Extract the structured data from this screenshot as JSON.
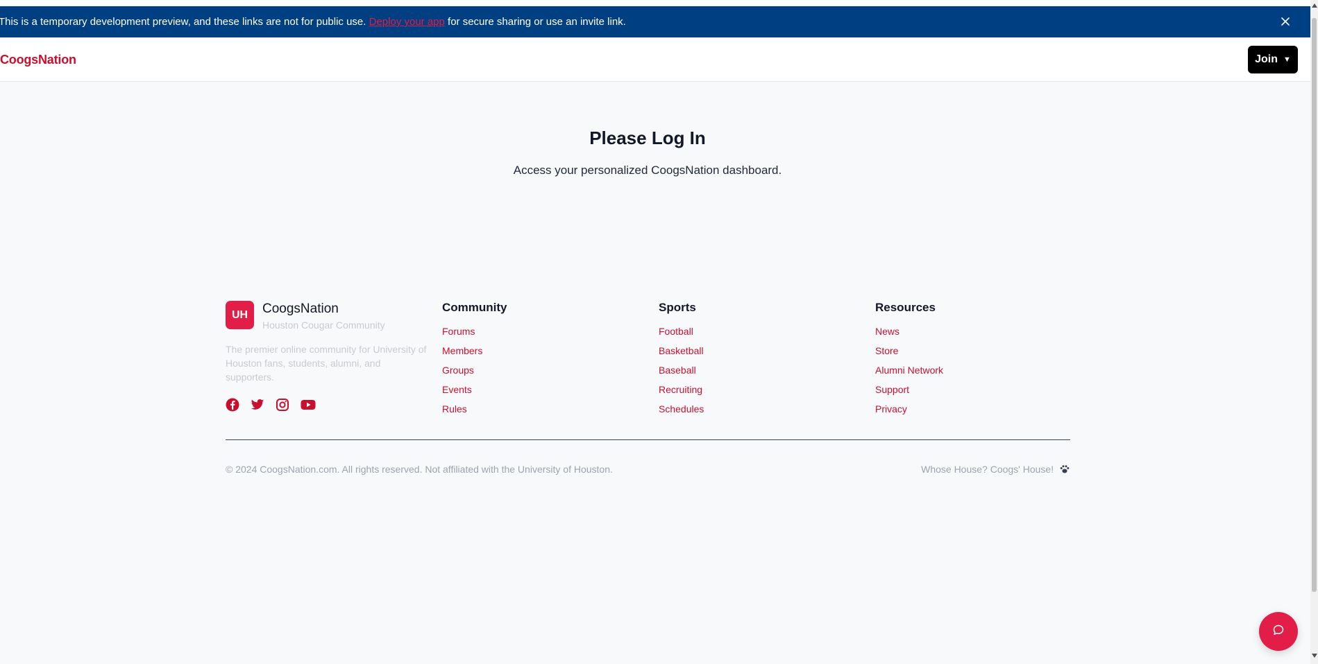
{
  "banner": {
    "text_before": "This is a temporary development preview, and these links are not for public use.",
    "link_text": "Deploy your app",
    "text_after": "for secure sharing or use an invite link.",
    "close_icon": "close-icon"
  },
  "header": {
    "brand": "CoogsNation",
    "join_label": "Join",
    "join_caret": "▼"
  },
  "hero": {
    "title": "Please Log In",
    "subtitle": "Access your personalized CoogsNation dashboard."
  },
  "footer": {
    "logo_text": "UH",
    "name": "CoogsNation",
    "tagline": "Houston Cougar Community",
    "description": "The premier online community for University of Houston fans, students, alumni, and supporters.",
    "socials": [
      "facebook-icon",
      "twitter-icon",
      "instagram-icon",
      "youtube-icon"
    ],
    "columns": [
      {
        "title": "Community",
        "links": [
          "Forums",
          "Members",
          "Groups",
          "Events",
          "Rules"
        ]
      },
      {
        "title": "Sports",
        "links": [
          "Football",
          "Basketball",
          "Baseball",
          "Recruiting",
          "Schedules"
        ]
      },
      {
        "title": "Resources",
        "links": [
          "News",
          "Store",
          "Alumni Network",
          "Support",
          "Privacy"
        ]
      }
    ],
    "copyright": "© 2024 CoogsNation.com. All rights reserved. Not affiliated with the University of Houston.",
    "motto": "Whose House? Coogs' House!",
    "motto_icon": "paw-icon"
  },
  "chat": {
    "icon": "chat-icon"
  },
  "colors": {
    "banner_bg": "#003f82",
    "brand_red": "#c8102e",
    "accent_red": "#e11d48",
    "page_bg": "#f8f9fb"
  }
}
